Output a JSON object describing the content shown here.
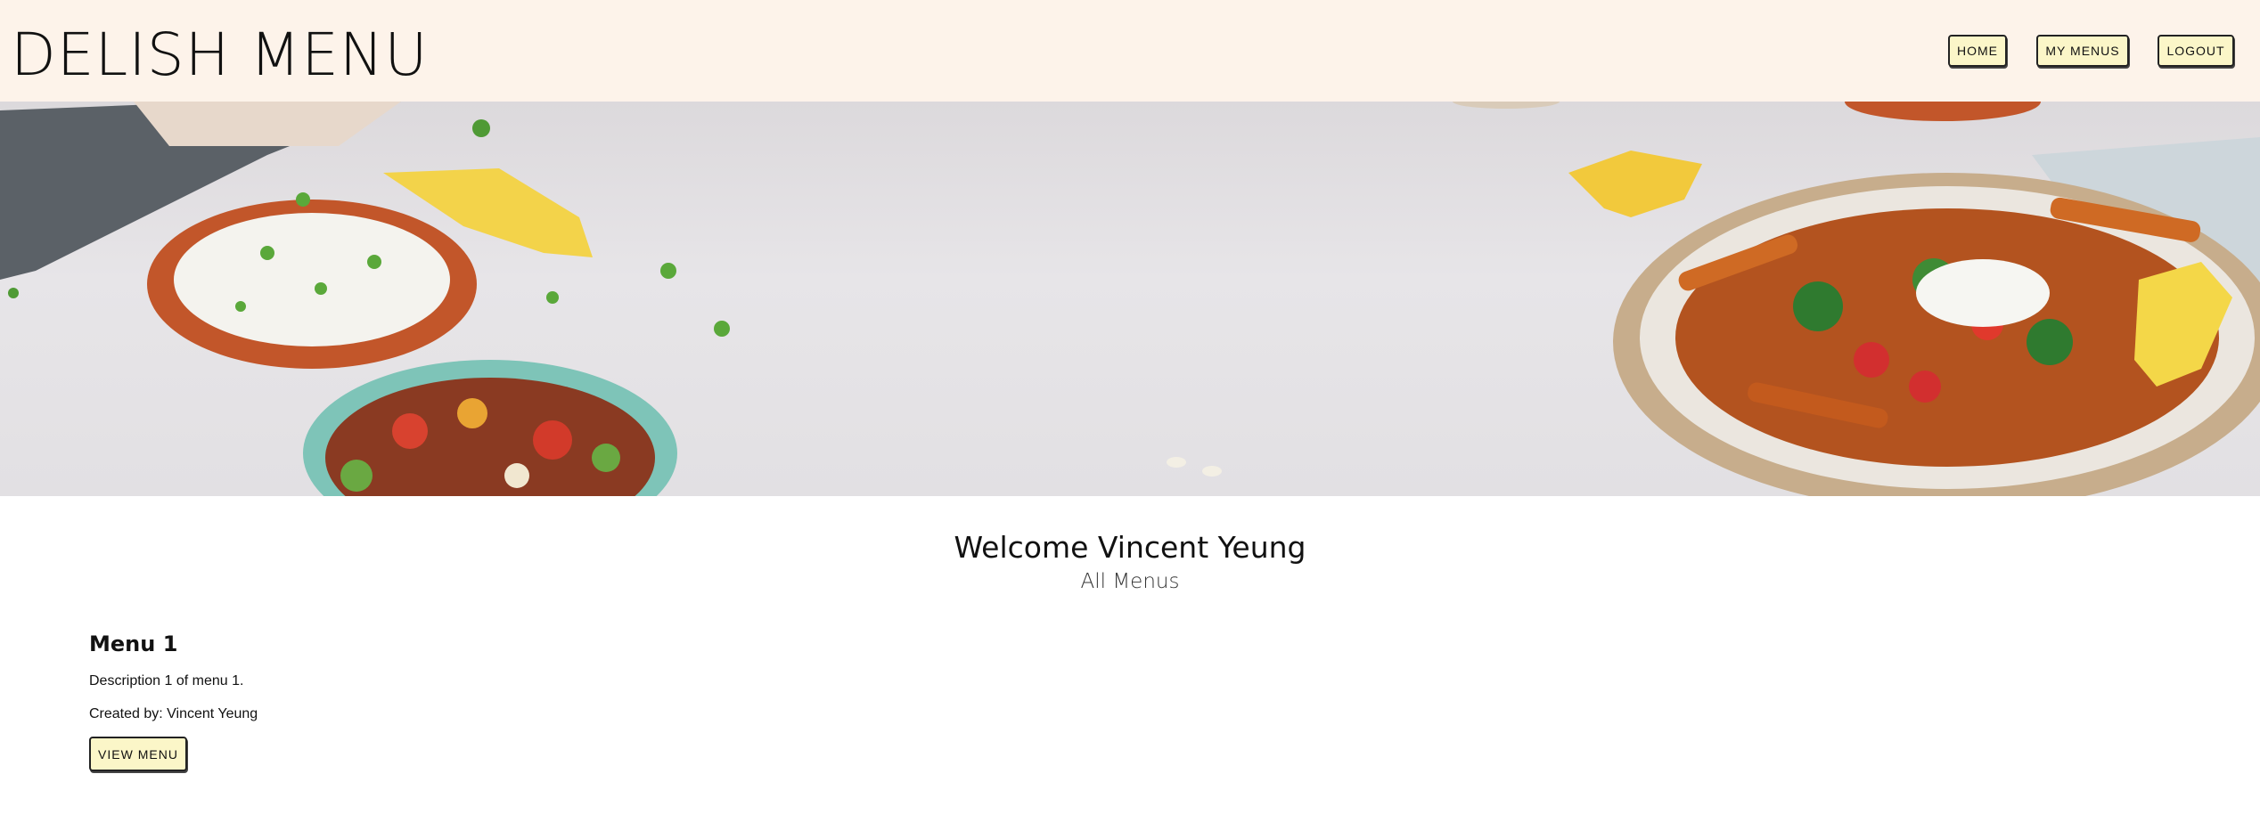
{
  "header": {
    "brand": "DELISH MENU",
    "nav": {
      "home": "HOME",
      "my_menus": "MY MENUS",
      "logout": "LOGOUT"
    }
  },
  "main": {
    "welcome": "Welcome Vincent Yeung",
    "subheading": "All Menus",
    "menus": [
      {
        "title": "Menu 1",
        "description": "Description 1 of menu 1.",
        "created_by": "Created by: Vincent Yeung",
        "button": "VIEW MENU"
      }
    ]
  },
  "colors": {
    "header_bg": "#fdf3ea",
    "button_bg": "#fbf6c8",
    "button_border": "#222222"
  }
}
